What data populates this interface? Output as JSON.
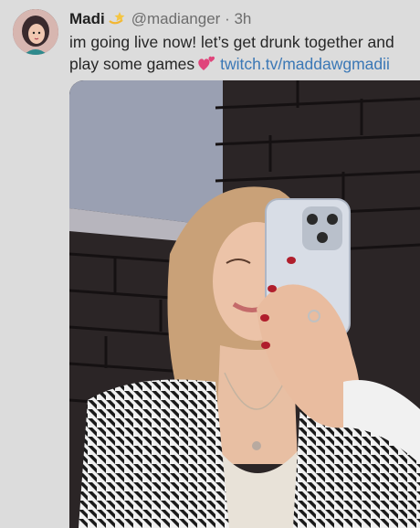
{
  "tweet": {
    "author_name": "Madi",
    "badge_icon": "dizzy-star-icon",
    "handle": "@madianger",
    "separator": "·",
    "time": "3h",
    "text": "im going live now! let’s get drunk together and play some games",
    "emoji_icon": "two-hearts-icon",
    "link": "twitch.tv/maddawgmadii",
    "image_icon": "selfie-photo"
  },
  "colors": {
    "background": "#dcdcdc",
    "link": "#3b78b6",
    "secondary_text": "#6d6d6d"
  }
}
